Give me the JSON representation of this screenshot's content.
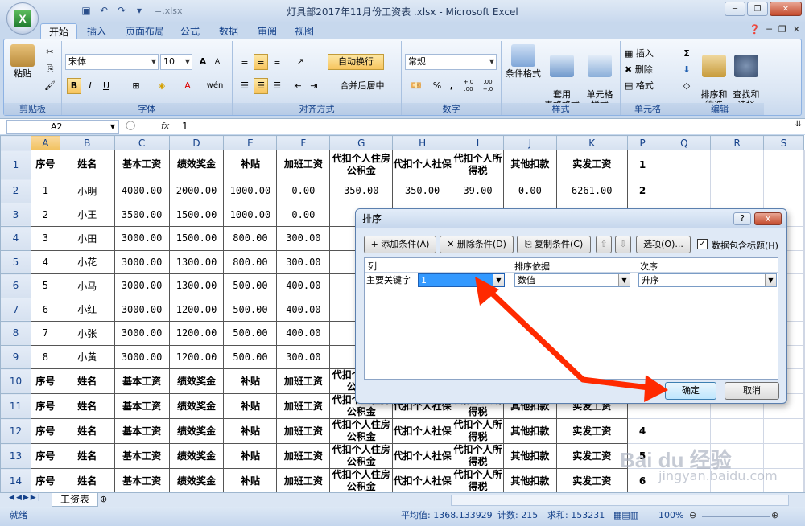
{
  "window": {
    "title": "灯具部2017年11月份工资表 .xlsx - Microsoft Excel",
    "qat_file_hint": "=.xlsx"
  },
  "tabs": [
    "开始",
    "插入",
    "页面布局",
    "公式",
    "数据",
    "审阅",
    "视图"
  ],
  "ribbon": {
    "clipboard": {
      "label": "剪贴板",
      "paste": "粘贴"
    },
    "font": {
      "label": "字体",
      "name": "宋体",
      "size": "10",
      "grow": "A",
      "shrink": "A",
      "bold": "B",
      "italic": "I",
      "underline": "U",
      "wubi": "wén"
    },
    "alignment": {
      "label": "对齐方式",
      "wrap": "自动换行",
      "merge": "合并后居中"
    },
    "number": {
      "label": "数字",
      "format": "常规",
      "percent": "%",
      "comma": ",",
      "inc_dec": "+.0 .00",
      "dec_dec": ".00 +.0"
    },
    "styles": {
      "label": "样式",
      "cond": "条件格式",
      "table": "套用\n表格格式",
      "cell": "单元格\n样式"
    },
    "cells": {
      "label": "单元格",
      "insert": "插入",
      "delete": "删除",
      "format": "格式"
    },
    "editing": {
      "label": "编辑",
      "sum": "Σ",
      "sort": "排序和\n筛选",
      "find": "查找和\n选择"
    }
  },
  "formula_bar": {
    "name_box": "A2",
    "fx": "fx",
    "value": "1"
  },
  "columns": [
    "A",
    "B",
    "C",
    "D",
    "E",
    "F",
    "G",
    "H",
    "I",
    "J",
    "K",
    "P",
    "Q",
    "R",
    "S"
  ],
  "header_row": [
    "序号",
    "姓名",
    "基本工资",
    "绩效奖金",
    "补贴",
    "加班工资",
    "代扣个人住房公积金",
    "代扣个人社保",
    "代扣个人所得税",
    "其他扣款",
    "实发工资"
  ],
  "data_rows": [
    {
      "row": "2",
      "cells": [
        "1",
        "小明",
        "4000.00",
        "2000.00",
        "1000.00",
        "0.00",
        "350.00",
        "350.00",
        "39.00",
        "0.00",
        "6261.00"
      ],
      "p": "2"
    },
    {
      "row": "3",
      "cells": [
        "2",
        "小王",
        "3500.00",
        "1500.00",
        "1000.00",
        "0.00",
        "30",
        "",
        "",
        "",
        ""
      ],
      "p": ""
    },
    {
      "row": "4",
      "cells": [
        "3",
        "小田",
        "3000.00",
        "1500.00",
        "800.00",
        "300.00",
        "28",
        "",
        "",
        "",
        ""
      ],
      "p": ""
    },
    {
      "row": "5",
      "cells": [
        "4",
        "小花",
        "3000.00",
        "1300.00",
        "800.00",
        "300.00",
        "27",
        "",
        "",
        "",
        ""
      ],
      "p": ""
    },
    {
      "row": "6",
      "cells": [
        "5",
        "小马",
        "3000.00",
        "1300.00",
        "500.00",
        "400.00",
        "26",
        "",
        "",
        "",
        ""
      ],
      "p": ""
    },
    {
      "row": "7",
      "cells": [
        "6",
        "小红",
        "3000.00",
        "1200.00",
        "500.00",
        "400.00",
        "25",
        "",
        "",
        "",
        ""
      ],
      "p": ""
    },
    {
      "row": "8",
      "cells": [
        "7",
        "小张",
        "3000.00",
        "1200.00",
        "500.00",
        "400.00",
        "25",
        "",
        "",
        "",
        ""
      ],
      "p": ""
    },
    {
      "row": "9",
      "cells": [
        "8",
        "小黄",
        "3000.00",
        "1200.00",
        "500.00",
        "300.00",
        "25",
        "",
        "",
        "",
        ""
      ],
      "p": ""
    }
  ],
  "repeat_rows": [
    {
      "row": "10",
      "p": ""
    },
    {
      "row": "11",
      "p": ""
    },
    {
      "row": "12",
      "p": "4"
    },
    {
      "row": "13",
      "p": "5"
    },
    {
      "row": "14",
      "p": "6"
    }
  ],
  "row1_p": "1",
  "sheet_tab": "工资表",
  "status": {
    "ready": "就绪",
    "average": "平均值: 1368.133929",
    "count": "计数: 215",
    "sum": "求和: 153231",
    "zoom": "100%"
  },
  "sort_dialog": {
    "title": "排序",
    "help": "?",
    "close": "x",
    "add_level": "添加条件(A)",
    "delete_level": "删除条件(D)",
    "copy_level": "复制条件(C)",
    "up": "⇧",
    "down": "⇩",
    "options": "选项(O)...",
    "has_headers": "数据包含标题(H)",
    "col_header": "列",
    "sort_on_header": "排序依据",
    "order_header": "次序",
    "primary_key_label": "主要关键字",
    "primary_key_value": "1",
    "sort_on_value": "数值",
    "order_value": "升序",
    "ok": "确定",
    "cancel": "取消"
  },
  "watermark": {
    "main": "Bai du 经验",
    "sub": "jingyan.baidu.com"
  },
  "colors": {
    "arrow": "#ff2a00",
    "selected": "#3399ff",
    "accent": "#15428b"
  }
}
